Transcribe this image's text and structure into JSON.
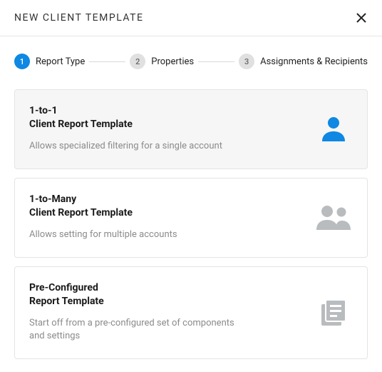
{
  "header": {
    "title": "NEW CLIENT TEMPLATE"
  },
  "stepper": {
    "steps": [
      {
        "num": "1",
        "label": "Report Type",
        "active": true
      },
      {
        "num": "2",
        "label": "Properties",
        "active": false
      },
      {
        "num": "3",
        "label": "Assignments & Recipients",
        "active": false
      }
    ]
  },
  "options": [
    {
      "titleLine1": "1-to-1",
      "titleLine2": "Client Report Template",
      "description": "Allows specialized filtering for a single account",
      "icon": "single-user-icon",
      "selected": true
    },
    {
      "titleLine1": "1-to-Many",
      "titleLine2": "Client Report Template",
      "description": "Allows setting for multiple accounts",
      "icon": "multi-user-icon",
      "selected": false
    },
    {
      "titleLine1": "Pre-Configured",
      "titleLine2": "Report Template",
      "description": "Start off from a pre-configured set of components and settings",
      "icon": "document-icon",
      "selected": false
    }
  ],
  "colors": {
    "accent": "#0e88e2",
    "muted": "#b9bcbe"
  }
}
